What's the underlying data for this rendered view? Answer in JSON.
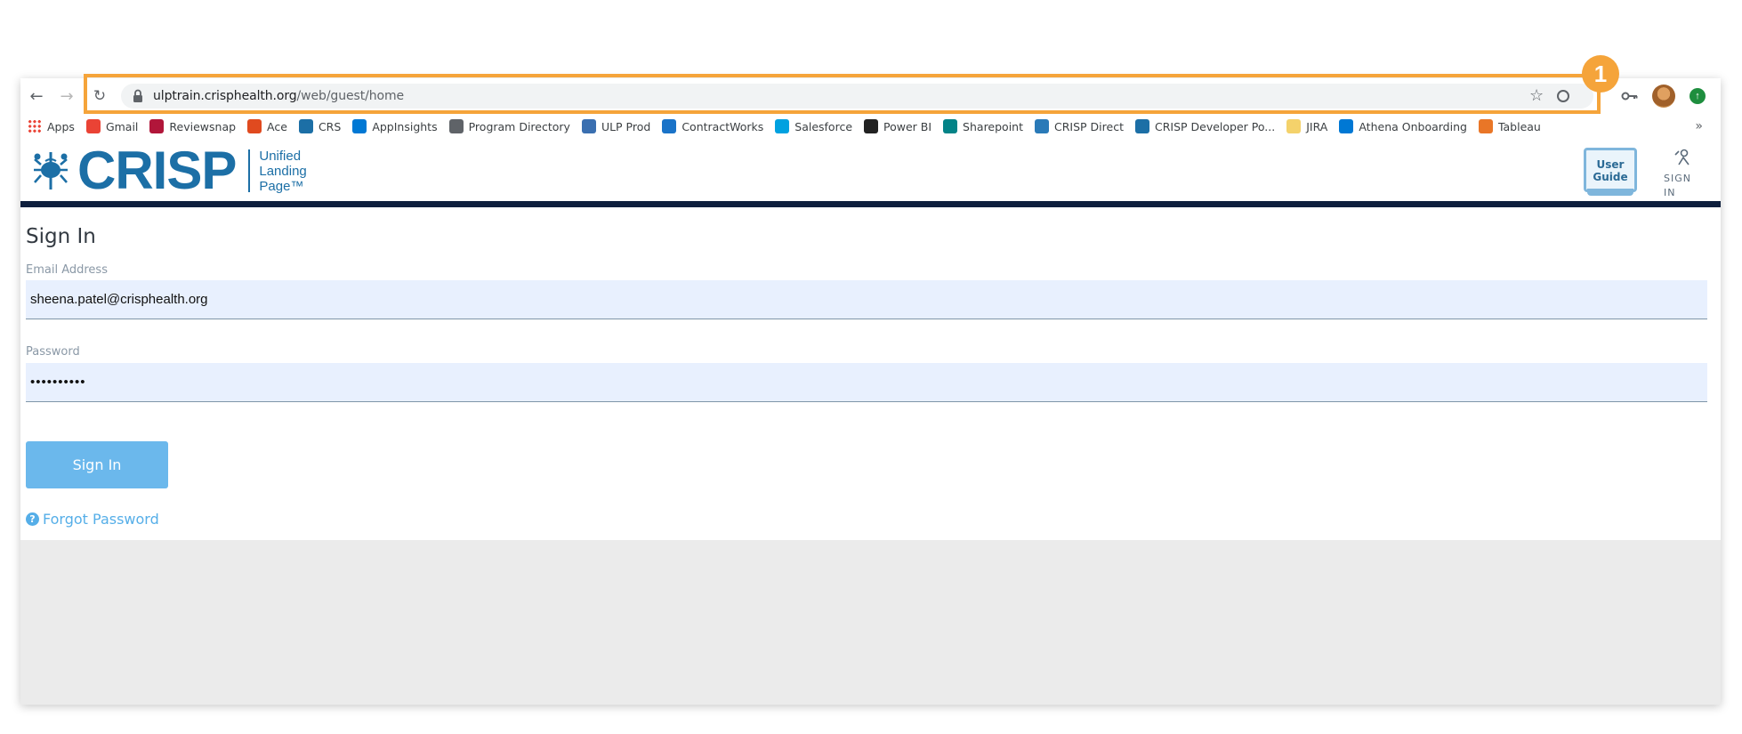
{
  "browser": {
    "url_host": "ulptrain.crisphealth.org",
    "url_path": "/web/guest/home"
  },
  "bookmarks": [
    {
      "label": "Apps",
      "icon": "apps-grid-icon",
      "color": "#4285f4"
    },
    {
      "label": "Gmail",
      "icon": "gmail-icon",
      "color": "#ea4335"
    },
    {
      "label": "Reviewsnap",
      "icon": "reviewsnap-icon",
      "color": "#b1163a"
    },
    {
      "label": "Ace",
      "icon": "ace-icon",
      "color": "#e04a1f"
    },
    {
      "label": "CRS",
      "icon": "crisp-crab-icon",
      "color": "#1c6fa6"
    },
    {
      "label": "AppInsights",
      "icon": "azure-icon",
      "color": "#0078d4"
    },
    {
      "label": "Program Directory",
      "icon": "globe-icon",
      "color": "#5f6368"
    },
    {
      "label": "ULP Prod",
      "icon": "ulp-icon",
      "color": "#3a6fb0"
    },
    {
      "label": "ContractWorks",
      "icon": "contractworks-icon",
      "color": "#1a73c8"
    },
    {
      "label": "Salesforce",
      "icon": "salesforce-cloud-icon",
      "color": "#00a1e0"
    },
    {
      "label": "Power BI",
      "icon": "power-bi-icon",
      "color": "#222222"
    },
    {
      "label": "Sharepoint",
      "icon": "sharepoint-icon",
      "color": "#038387"
    },
    {
      "label": "CRISP Direct",
      "icon": "crisp-direct-icon",
      "color": "#2a7ab8"
    },
    {
      "label": "CRISP Developer Po...",
      "icon": "crisp-crab-icon",
      "color": "#1c6fa6"
    },
    {
      "label": "JIRA",
      "icon": "jira-folder-icon",
      "color": "#f4d26b"
    },
    {
      "label": "Athena Onboarding",
      "icon": "azure-devops-icon",
      "color": "#0078d4"
    },
    {
      "label": "Tableau",
      "icon": "tableau-icon",
      "color": "#e97627"
    }
  ],
  "bookmarks_overflow": "»",
  "callout": {
    "number": "1",
    "color": "#f5a43a"
  },
  "header": {
    "logo_word": "CRISP",
    "logo_tag": [
      "Unified",
      "Landing",
      "Page™"
    ],
    "user_guide_line1": "User",
    "user_guide_line2": "Guide",
    "signin_line1": "SIGN",
    "signin_line2": "IN"
  },
  "form": {
    "title": "Sign In",
    "email_label": "Email Address",
    "email_value": "sheena.patel@crisphealth.org",
    "password_label": "Password",
    "password_value": "••••••••••",
    "submit_label": "Sign In",
    "forgot_label": "Forgot Password"
  },
  "colors": {
    "brand_blue": "#1c6fa6",
    "header_rule": "#0e1f3d",
    "button": "#6bb8ec",
    "link": "#55aee8",
    "input_bg": "#e8f0fe",
    "footer_bg": "#ebebeb"
  }
}
